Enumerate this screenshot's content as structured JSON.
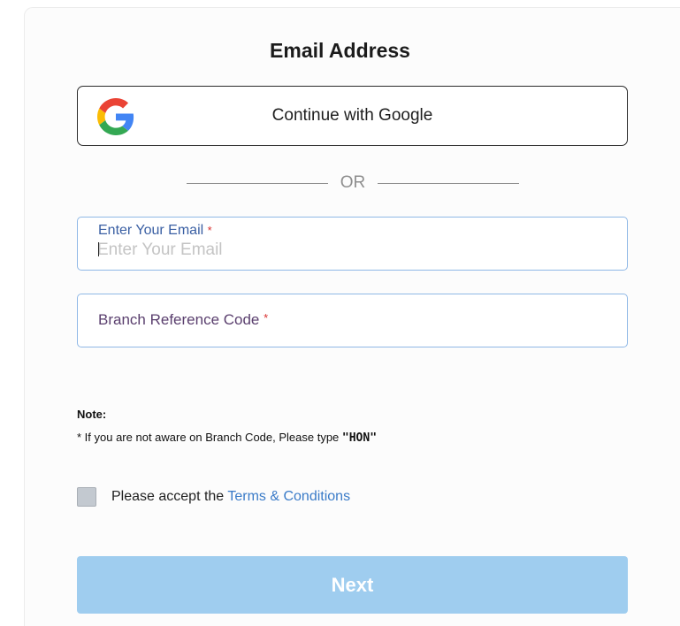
{
  "form": {
    "title": "Email Address",
    "google_button_label": "Continue with Google",
    "separator": "OR",
    "email": {
      "label": "Enter Your Email",
      "required_mark": "*",
      "placeholder": "Enter Your Email",
      "value": ""
    },
    "branch": {
      "label": "Branch Reference Code",
      "required_mark": "*",
      "value": ""
    },
    "note": {
      "title": "Note:",
      "text_prefix": "* If you are not aware on Branch Code, Please type ",
      "code": "\"HON\""
    },
    "terms": {
      "prefix": "Please accept the ",
      "link": "Terms & Conditions",
      "checked": false
    },
    "next_label": "Next"
  },
  "colors": {
    "google_blue": "#4285F4",
    "google_red": "#EA4335",
    "google_yellow": "#FBBC05",
    "google_green": "#34A853",
    "field_border": "#8fb8e6",
    "required": "#d9302f",
    "link": "#3a7bc8",
    "next_button": "#9fcdef"
  }
}
